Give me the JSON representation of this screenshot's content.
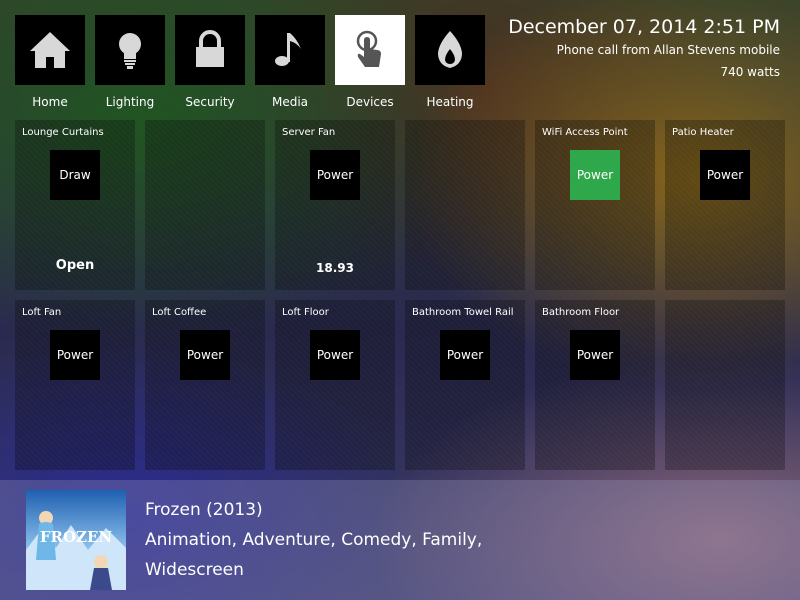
{
  "nav": {
    "items": [
      {
        "label": "Home",
        "icon": "home-icon"
      },
      {
        "label": "Lighting",
        "icon": "lightbulb-icon"
      },
      {
        "label": "Security",
        "icon": "lock-icon"
      },
      {
        "label": "Media",
        "icon": "music-note-icon"
      },
      {
        "label": "Devices",
        "icon": "touch-icon",
        "active": true
      },
      {
        "label": "Heating",
        "icon": "flame-icon"
      }
    ]
  },
  "header": {
    "datetime": "December 07, 2014 2:51 PM",
    "call": "Phone call from Allan Stevens mobile",
    "watts": "740  watts"
  },
  "devices": [
    {
      "title": "Lounge Curtains",
      "button": "Draw",
      "value": "Open"
    },
    {
      "title": ""
    },
    {
      "title": "Server Fan",
      "button": "Power",
      "value": "18.93"
    },
    {
      "title": ""
    },
    {
      "title": "WiFi Access Point",
      "button": "Power",
      "on": true
    },
    {
      "title": "Patio Heater",
      "button": "Power"
    },
    {
      "title": "Loft Fan",
      "button": "Power"
    },
    {
      "title": "Loft Coffee",
      "button": "Power"
    },
    {
      "title": "Loft Floor",
      "button": "Power"
    },
    {
      "title": "Bathroom Towel Rail",
      "button": "Power"
    },
    {
      "title": "Bathroom Floor",
      "button": "Power"
    },
    {
      "title": ""
    }
  ],
  "media": {
    "title": "Frozen (2013)",
    "genres": "Animation, Adventure, Comedy, Family,",
    "format": "Widescreen",
    "poster_text": "FROZEN"
  },
  "colors": {
    "active_tile": "#ffffff",
    "power_on": "#2ea84a",
    "tile_button": "#000000"
  }
}
